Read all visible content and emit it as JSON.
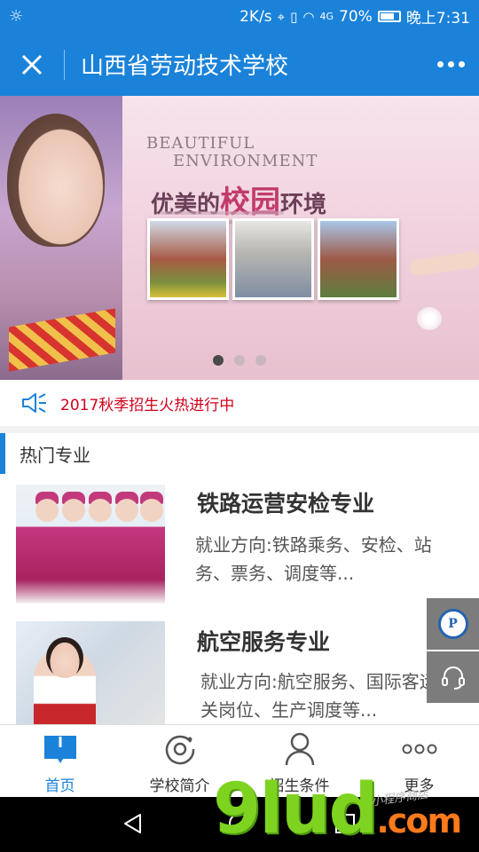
{
  "status_bar": {
    "net_speed": "2K/s",
    "signal": "4G",
    "battery": "70%",
    "time": "晚上7:31"
  },
  "header": {
    "title": "山西省劳动技术学校",
    "close_icon": "close-icon",
    "more_icon": "more-dots-icon"
  },
  "banner": {
    "headline_en_1": "BEAUTIFUL",
    "headline_en_2": "ENVIRONMENT",
    "headline_cn_a": "优美的",
    "headline_cn_b": "校园",
    "headline_cn_c": "环境",
    "slide_count": 3,
    "active_slide": 1
  },
  "notice": {
    "icon": "speaker-icon",
    "text": "2017秋季招生火热进行中",
    "color": "#d0021b"
  },
  "section": {
    "title": "热门专业"
  },
  "majors": [
    {
      "name": "铁路运营安检专业",
      "desc": "就业方向:铁路乘务、安检、站务、票务、调度等..."
    },
    {
      "name": "航空服务专业",
      "desc": "就业方向:航空服务、国际客运相关岗位、生产调度等..."
    }
  ],
  "tabs": [
    {
      "label": "首页",
      "icon": "home-book-icon",
      "active": true
    },
    {
      "label": "学校简介",
      "icon": "school-intro-icon",
      "active": false
    },
    {
      "label": "招生条件",
      "icon": "user-icon",
      "active": false
    },
    {
      "label": "更多",
      "icon": "more-icon",
      "active": false
    }
  ],
  "watermark": {
    "brand": "9lud",
    "domain": ".com",
    "tagline": "小程序商店"
  },
  "colors": {
    "primary": "#1a82d9",
    "notice_red": "#d0021b",
    "float_grey": "#7c7c7c"
  }
}
